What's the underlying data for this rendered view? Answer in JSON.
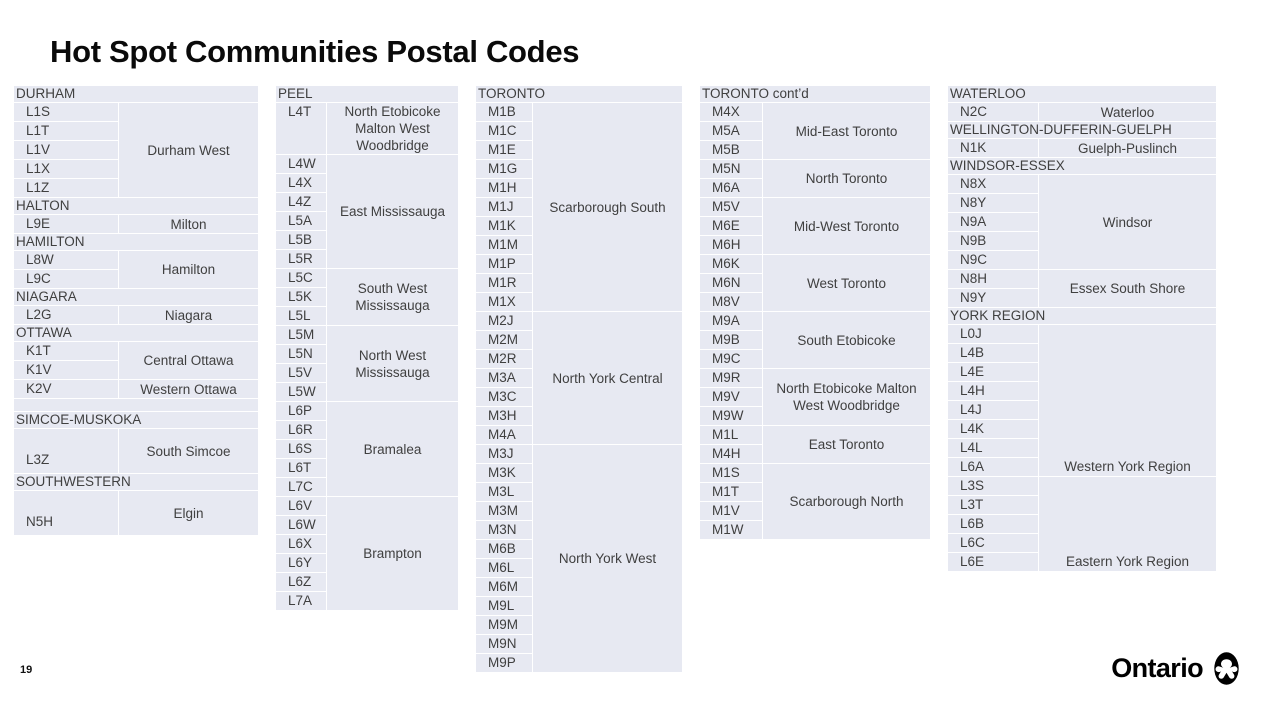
{
  "slide": {
    "title": "Hot Spot Communities Postal Codes",
    "page_number": "19",
    "logo_wordmark": "Ontario",
    "colors": {
      "cell_background": "#e7e9f2",
      "grid_line": "#ffffff",
      "text": "#404040",
      "title_text": "#0a0a0a",
      "page_background": "#ffffff"
    }
  },
  "columns": [
    {
      "id": "durham",
      "blocks": [
        {
          "type": "region",
          "name": "DURHAM"
        },
        {
          "type": "group",
          "codes": [
            "L1S",
            "L1T",
            "L1V",
            "L1X",
            "L1Z"
          ],
          "community": "Durham West"
        },
        {
          "type": "region",
          "name": "HALTON"
        },
        {
          "type": "group",
          "codes": [
            "L9E"
          ],
          "community": "Milton"
        },
        {
          "type": "region",
          "name": "HAMILTON"
        },
        {
          "type": "group",
          "codes": [
            "L8W",
            "L9C"
          ],
          "community": "Hamilton"
        },
        {
          "type": "region",
          "name": "NIAGARA"
        },
        {
          "type": "group",
          "codes": [
            "L2G"
          ],
          "community": "Niagara"
        },
        {
          "type": "region",
          "name": "OTTAWA"
        },
        {
          "type": "group",
          "codes": [
            "K1T",
            "K1V"
          ],
          "community": "Central Ottawa"
        },
        {
          "type": "group",
          "codes": [
            "K2V"
          ],
          "community": "Western Ottawa"
        },
        {
          "type": "spacer"
        },
        {
          "type": "region",
          "name": "SIMCOE-MUSKOKA"
        },
        {
          "type": "group",
          "tall": true,
          "codes": [
            "L3Z"
          ],
          "community": "South Simcoe"
        },
        {
          "type": "region",
          "name": "SOUTHWESTERN"
        },
        {
          "type": "group",
          "tall": true,
          "codes": [
            "N5H"
          ],
          "community": "Elgin"
        }
      ]
    },
    {
      "id": "peel",
      "blocks": [
        {
          "type": "region",
          "name": "PEEL"
        },
        {
          "type": "group",
          "codes": [
            "L4T"
          ],
          "community": "North Etobicoke Malton West Woodbridge",
          "lines": 3
        },
        {
          "type": "group",
          "codes": [
            "L4W",
            "L4X",
            "L4Z",
            "L5A",
            "L5B",
            "L5R"
          ],
          "community": "East Mississauga"
        },
        {
          "type": "group",
          "codes": [
            "L5C",
            "L5K",
            "L5L"
          ],
          "community": "South West Mississauga"
        },
        {
          "type": "group",
          "codes": [
            "L5M",
            "L5N",
            "L5V",
            "L5W"
          ],
          "community": "North West Mississauga"
        },
        {
          "type": "group",
          "codes": [
            "L6P",
            "L6R",
            "L6S",
            "L6T",
            "L7C"
          ],
          "community": "Bramalea"
        },
        {
          "type": "group",
          "codes": [
            "L6V",
            "L6W",
            "L6X",
            "L6Y",
            "L6Z",
            "L7A"
          ],
          "community": "Brampton"
        }
      ]
    },
    {
      "id": "toronto",
      "blocks": [
        {
          "type": "region",
          "name": "TORONTO"
        },
        {
          "type": "group",
          "codes": [
            "M1B",
            "M1C",
            "M1E",
            "M1G",
            "M1H",
            "M1J",
            "M1K",
            "M1M",
            "M1P",
            "M1R",
            "M1X"
          ],
          "community": "Scarborough South"
        },
        {
          "type": "group",
          "codes": [
            "M2J",
            "M2M",
            "M2R",
            "M3A",
            "M3C",
            "M3H",
            "M4A"
          ],
          "community": "North York Central"
        },
        {
          "type": "group",
          "codes": [
            "M3J",
            "M3K",
            "M3L",
            "M3M",
            "M3N",
            "M6B",
            "M6L",
            "M6M",
            "M9L",
            "M9M",
            "M9N",
            "M9P"
          ],
          "community": "North York West"
        }
      ]
    },
    {
      "id": "toronto-contd",
      "blocks": [
        {
          "type": "region",
          "name": "TORONTO cont’d"
        },
        {
          "type": "group",
          "codes": [
            "M4X",
            "M5A",
            "M5B"
          ],
          "community": "Mid-East Toronto"
        },
        {
          "type": "group",
          "codes": [
            "M5N",
            "M6A"
          ],
          "community": "North Toronto"
        },
        {
          "type": "group",
          "codes": [
            "M5V",
            "M6E",
            "M6H"
          ],
          "community": "Mid-West Toronto"
        },
        {
          "type": "group",
          "codes": [
            "M6K",
            "M6N",
            "M8V"
          ],
          "community": "West Toronto"
        },
        {
          "type": "group",
          "codes": [
            "M9A",
            "M9B",
            "M9C"
          ],
          "community": "South Etobicoke"
        },
        {
          "type": "group",
          "codes": [
            "M9R",
            "M9V",
            "M9W"
          ],
          "community": "North Etobicoke Malton West Woodbridge",
          "lines": 2
        },
        {
          "type": "group",
          "codes": [
            "M1L",
            "M4H"
          ],
          "community": "East Toronto"
        },
        {
          "type": "group",
          "codes": [
            "M1S",
            "M1T",
            "M1V",
            "M1W"
          ],
          "community": "Scarborough North"
        }
      ]
    },
    {
      "id": "waterloo",
      "blocks": [
        {
          "type": "region",
          "name": "WATERLOO"
        },
        {
          "type": "group",
          "codes": [
            "N2C"
          ],
          "community": "Waterloo"
        },
        {
          "type": "region",
          "name": "WELLINGTON-DUFFERIN-GUELPH"
        },
        {
          "type": "group",
          "codes": [
            "N1K"
          ],
          "community": "Guelph-Puslinch"
        },
        {
          "type": "region",
          "name": "WINDSOR-ESSEX"
        },
        {
          "type": "group",
          "codes": [
            "N8X",
            "N8Y",
            "N9A",
            "N9B",
            "N9C"
          ],
          "community": "Windsor"
        },
        {
          "type": "group",
          "codes": [
            "N8H",
            "N9Y"
          ],
          "community": "Essex South Shore"
        },
        {
          "type": "region",
          "name": "YORK REGION"
        },
        {
          "type": "group",
          "codes": [
            "L0J",
            "L4B",
            "L4E",
            "L4H",
            "L4J",
            "L4K",
            "L4L",
            "L6A"
          ],
          "community": "Western York Region",
          "align": "bottom"
        },
        {
          "type": "group",
          "codes": [
            "L3S",
            "L3T",
            "L6B",
            "L6C",
            "L6E"
          ],
          "community": "Eastern York Region",
          "align": "bottom"
        }
      ]
    }
  ]
}
